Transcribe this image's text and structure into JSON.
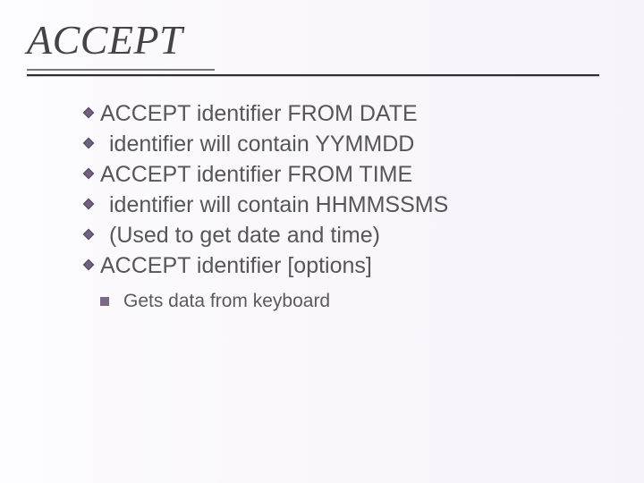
{
  "title": "ACCEPT",
  "bullets": [
    {
      "text": "ACCEPT identifier FROM DATE",
      "indent": false
    },
    {
      "text": "identifier will contain YYMMDD",
      "indent": true
    },
    {
      "text": "ACCEPT identifier FROM TIME",
      "indent": false
    },
    {
      "text": "identifier will contain HHMMSSMS",
      "indent": true
    },
    {
      "text": "(Used to get date and time)",
      "indent": true
    },
    {
      "text": "ACCEPT identifier [options]",
      "indent": false
    }
  ],
  "subpoint": "Gets data from keyboard",
  "colors": {
    "bullet_fill": "#726083",
    "bullet_stroke": "#4d3f5a"
  }
}
